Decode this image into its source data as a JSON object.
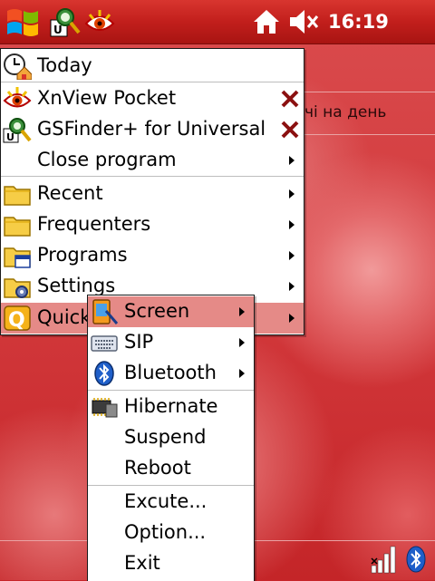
{
  "taskbar": {
    "time": "16:19"
  },
  "today_screen": {
    "text_fragment": "чі на день"
  },
  "main_menu": {
    "items": [
      {
        "label": "Today",
        "icon": "today-icon"
      },
      {
        "label": "XnView Pocket",
        "icon": "xnview-icon",
        "close": true
      },
      {
        "label": "GSFinder+ for Universal",
        "icon": "gsfinder-icon",
        "close": true
      },
      {
        "label": "Close program",
        "submenu": true
      },
      {
        "label": "Recent",
        "icon": "folder-icon",
        "submenu": true
      },
      {
        "label": "Frequenters",
        "icon": "folder-icon",
        "submenu": true
      },
      {
        "label": "Programs",
        "icon": "programs-folder-icon",
        "submenu": true
      },
      {
        "label": "Settings",
        "icon": "settings-folder-icon",
        "submenu": true
      },
      {
        "label": "Quick",
        "icon": "quick-icon",
        "submenu": true
      }
    ]
  },
  "quick_submenu": {
    "items": [
      {
        "label": "Screen",
        "icon": "screen-icon",
        "submenu": true,
        "highlighted": true
      },
      {
        "label": "SIP",
        "icon": "keyboard-icon",
        "submenu": true
      },
      {
        "label": "Bluetooth",
        "icon": "bluetooth-icon",
        "submenu": true
      },
      {
        "label": "Hibernate",
        "icon": "hibernate-icon"
      },
      {
        "label": "Suspend"
      },
      {
        "label": "Reboot"
      },
      {
        "label": "Excute..."
      },
      {
        "label": "Option..."
      },
      {
        "label": "Exit"
      }
    ]
  },
  "colors": {
    "taskbar": "#c21f1c",
    "highlight": "#e58a87",
    "close_x": "#8b1010"
  }
}
